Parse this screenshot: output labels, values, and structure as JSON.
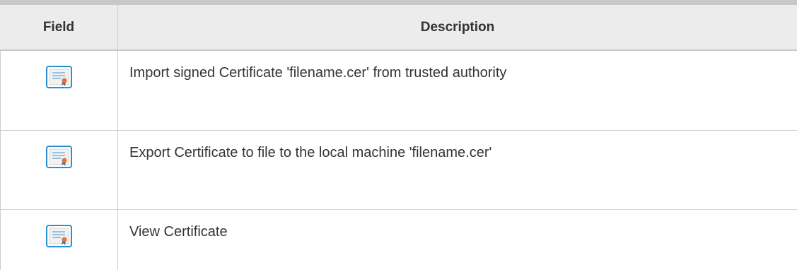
{
  "table": {
    "headers": {
      "field": "Field",
      "description": "Description"
    },
    "rows": [
      {
        "icon": "certificate-icon",
        "description": "Import signed Certificate 'filename.cer' from trusted authority"
      },
      {
        "icon": "certificate-icon",
        "description": "Export Certificate to file to the local machine 'filename.cer'"
      },
      {
        "icon": "certificate-icon",
        "description": "View Certificate"
      }
    ]
  },
  "colors": {
    "header_bg": "#ececec",
    "border": "#c8c8c8",
    "icon_border": "#2a8fd0",
    "ribbon": "#e8732a"
  }
}
